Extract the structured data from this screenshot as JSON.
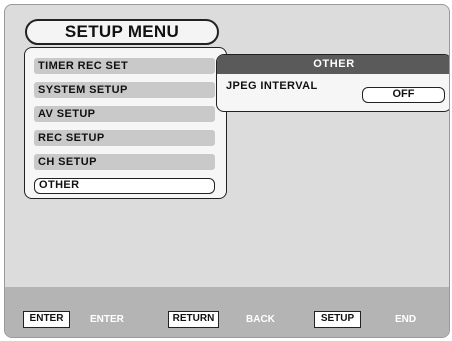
{
  "title": "SETUP MENU",
  "menu": {
    "items": [
      {
        "label": "TIMER REC SET",
        "selected": false
      },
      {
        "label": "SYSTEM SETUP",
        "selected": false
      },
      {
        "label": "AV SETUP",
        "selected": false
      },
      {
        "label": "REC SETUP",
        "selected": false
      },
      {
        "label": "CH SETUP",
        "selected": false
      },
      {
        "label": "OTHER",
        "selected": true
      }
    ]
  },
  "submenu": {
    "title": "OTHER",
    "options": [
      {
        "label": "JPEG INTERVAL",
        "value": "OFF"
      }
    ]
  },
  "footer": {
    "keys": [
      {
        "key": "ENTER",
        "action": "ENTER"
      },
      {
        "key": "RETURN",
        "action": "BACK"
      },
      {
        "key": "SETUP",
        "action": "END"
      }
    ]
  },
  "colors": {
    "background": "#dcdcdc",
    "panel": "#f6f6f6",
    "item": "#c9c9c9",
    "header": "#5a5a5a",
    "footer": "#b4b4b4",
    "border": "#222222"
  }
}
